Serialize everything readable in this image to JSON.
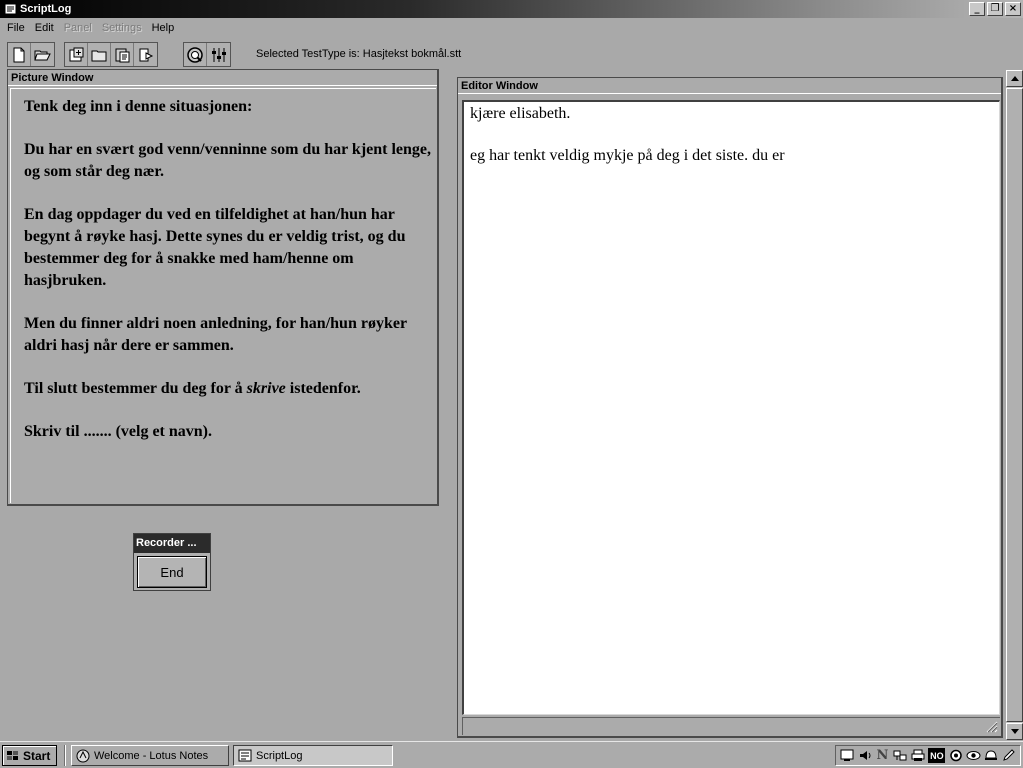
{
  "window": {
    "title": "ScriptLog",
    "minimize": "_",
    "maximize": "❐",
    "close": "×"
  },
  "menu": {
    "items": [
      {
        "label": "File",
        "enabled": true
      },
      {
        "label": "Edit",
        "enabled": true
      },
      {
        "label": "Panel",
        "enabled": false
      },
      {
        "label": "Settings",
        "enabled": false
      },
      {
        "label": "Help",
        "enabled": true
      }
    ]
  },
  "toolbar": {
    "selected_testtype": "Selected TestType is: Hasjtekst bokmål.stt",
    "icons": [
      "new-file-icon",
      "open-folder-icon",
      "add-picture-icon",
      "folder-icon",
      "paste-icon",
      "replay-icon",
      "playback-icon",
      "equalizer-icon"
    ]
  },
  "picture_window": {
    "title": "Picture Window",
    "paragraphs": [
      "Tenk deg inn i denne situasjonen:",
      "Du har en svært god venn/venninne som du har kjent lenge, og som står deg nær.",
      "En dag oppdager du ved en tilfeldighet at han/hun har begynt å røyke hasj. Dette synes du er veldig trist, og du bestemmer deg for å snakke med ham/henne om hasjbruken.",
      "Men du finner aldri noen anledning, for han/hun røyker aldri hasj når dere er sammen."
    ],
    "p5_before": "Til slutt bestemmer du deg for å ",
    "p5_emphasis": "skrive",
    "p5_after": " istedenfor.",
    "p6": "Skriv til ....... (velg et navn)."
  },
  "recorder": {
    "title": "Recorder ...",
    "end_label": "End"
  },
  "editor_window": {
    "title": "Editor Window",
    "line1": "kjære elisabeth.",
    "line2": "eg har tenkt veldig mykje på deg i det siste. du er"
  },
  "taskbar": {
    "start_label": "Start",
    "tasks": [
      {
        "label": "Welcome - Lotus Notes",
        "active": false
      },
      {
        "label": "ScriptLog",
        "active": true
      }
    ],
    "tray_icons": [
      "display-icon",
      "speaker-icon",
      "n-icon",
      "network-icon",
      "print-icon",
      "no-icon",
      "settings-icon",
      "eye-icon",
      "helmet-icon",
      "pencil-icon"
    ],
    "tray_no_label": "NO",
    "tray_n_label": "N"
  },
  "colors": {
    "background": "#a9a9a9",
    "editor_bg": "#ffffff",
    "title_bar": "#000000"
  }
}
